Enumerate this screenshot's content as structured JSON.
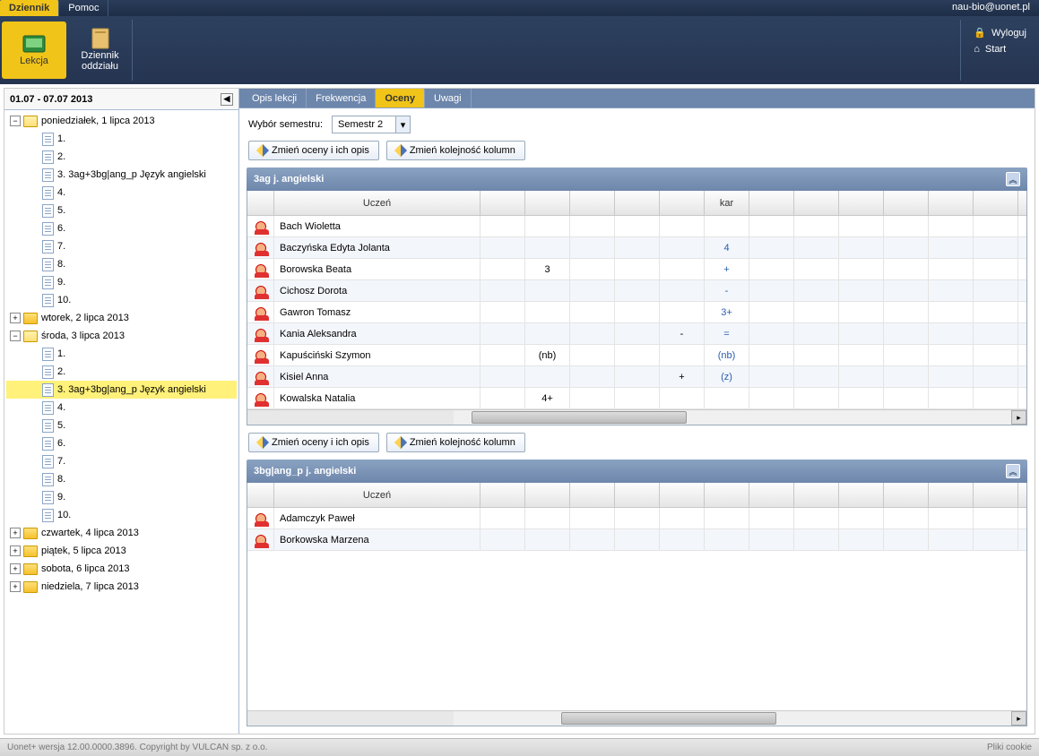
{
  "topMenu": {
    "dziennik": "Dziennik",
    "pomoc": "Pomoc",
    "user": "nau-bio@uonet.pl"
  },
  "ribbon": {
    "lekcja": "Lekcja",
    "dziennikOddzialu": "Dziennik\noddziału",
    "wyloguj": "Wyloguj",
    "start": "Start"
  },
  "sidebar": {
    "period": "01.07 - 07.07 2013",
    "days": {
      "pon": "poniedziałek, 1 lipca 2013",
      "wt": "wtorek, 2 lipca 2013",
      "sr": "środa, 3 lipca 2013",
      "czw": "czwartek, 4 lipca 2013",
      "pt": "piątek, 5 lipca 2013",
      "sob": "sobota, 6 lipca 2013",
      "nd": "niedziela, 7 lipca 2013"
    },
    "slots": {
      "s1": "1.",
      "s2": "2.",
      "s3": "3. 3ag+3bg|ang_p Język angielski",
      "s4": "4.",
      "s5": "5.",
      "s6": "6.",
      "s7": "7.",
      "s8": "8.",
      "s9": "9.",
      "s10": "10."
    },
    "srSlots": {
      "s1": "1.",
      "s2": "2.",
      "s3": "3. 3ag+3bg|ang_p Język angielski",
      "s4": "4.",
      "s5": "5.",
      "s6": "6.",
      "s7": "7.",
      "s8": "8.",
      "s9": "9.",
      "s10": "10."
    }
  },
  "tabs": {
    "opis": "Opis lekcji",
    "frek": "Frekwencja",
    "oceny": "Oceny",
    "uwagi": "Uwagi"
  },
  "semesterLabel": "Wybór semestru:",
  "semesterValue": "Semestr 2",
  "buttons": {
    "zmienOceny": "Zmień oceny i ich opis",
    "zmienKol": "Zmień kolejność kolumn"
  },
  "panel1": {
    "title": "3ag j. angielski",
    "colUczen": "Uczeń",
    "colKar": "kar",
    "rows": [
      {
        "name": "Bach Wioletta",
        "c": [
          "",
          "",
          "",
          "",
          "",
          "",
          "",
          ""
        ]
      },
      {
        "name": "Baczyńska Edyta Jolanta",
        "c": [
          "",
          "",
          "",
          "",
          "",
          "4",
          "",
          ""
        ]
      },
      {
        "name": "Borowska Beata",
        "c": [
          "",
          "3",
          "",
          "",
          "",
          "+",
          "",
          ""
        ]
      },
      {
        "name": "Cichosz Dorota",
        "c": [
          "",
          "",
          "",
          "",
          "",
          "-",
          "",
          ""
        ]
      },
      {
        "name": "Gawron Tomasz",
        "c": [
          "",
          "",
          "",
          "",
          "",
          "3+",
          "",
          ""
        ]
      },
      {
        "name": "Kania Aleksandra",
        "c": [
          "",
          "",
          "",
          "",
          "-",
          "=",
          "",
          ""
        ]
      },
      {
        "name": "Kapuściński Szymon",
        "c": [
          "",
          "(nb)",
          "",
          "",
          "",
          "(nb)",
          "",
          ""
        ]
      },
      {
        "name": "Kisiel Anna",
        "c": [
          "",
          "",
          "",
          "",
          "+",
          "(z)",
          "",
          ""
        ]
      },
      {
        "name": "Kowalska Natalia",
        "c": [
          "",
          "4+",
          "",
          "",
          "",
          "",
          "",
          ""
        ]
      }
    ]
  },
  "panel2": {
    "title": "3bg|ang_p j. angielski",
    "colUczen": "Uczeń",
    "rows": [
      {
        "name": "Adamczyk Paweł"
      },
      {
        "name": "Borkowska Marzena"
      }
    ]
  },
  "footer": {
    "version": "Uonet+ wersja 12.00.0000.3896. Copyright by VULCAN sp. z o.o.",
    "cookie": "Pliki cookie"
  }
}
